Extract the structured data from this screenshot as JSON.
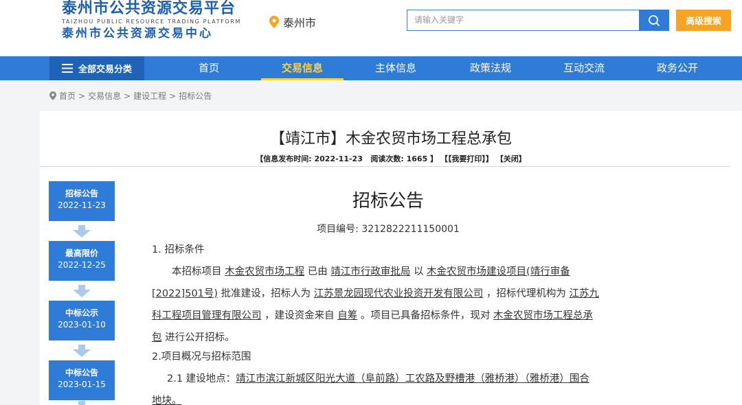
{
  "header": {
    "logo_cn_1": "泰州市公共资源交易平台",
    "logo_en": "TAIZHOU PUBLIC RESOURCE TRADING PLATFORM",
    "logo_cn_2": "泰州市公共资源交易中心",
    "city": "泰州市",
    "search_placeholder": "请输入关键字",
    "advanced_search": "高级搜索"
  },
  "nav": {
    "all_categories": "全部交易分类",
    "items": [
      "首页",
      "交易信息",
      "主体信息",
      "政策法规",
      "互动交流",
      "政务公开"
    ],
    "active_index": 1
  },
  "breadcrumb": [
    "首页",
    ">",
    "交易信息",
    ">",
    "建设工程",
    ">",
    "招标公告"
  ],
  "article": {
    "title": "【靖江市】木金农贸市场工程总承包",
    "meta": {
      "publish_label": "【信息发布时间:",
      "publish_date": "2022-11-23",
      "views_label": "阅读次数:",
      "views": "1665",
      "close_bracket": "】",
      "print": "【【我要打印】】",
      "close": "【关闭】"
    }
  },
  "timeline": [
    {
      "label": "招标公告",
      "date": "2022-11-23"
    },
    {
      "label": "最高限价",
      "date": "2022-12-25"
    },
    {
      "label": "中标公示",
      "date": "2023-01-10"
    },
    {
      "label": "中标公告",
      "date": "2023-01-15"
    }
  ],
  "doc": {
    "heading": "招标公告",
    "project_no_label": "项目编号:",
    "project_no": "3212822211150001",
    "sec1_title": "1. 招标条件",
    "p1": {
      "t1": "本招标项目",
      "project": "木金农贸市场工程",
      "t2": "已由",
      "approver": "靖江市行政审批局",
      "t3": "以",
      "approval_1": "木金农贸市场建设项目(靖行审备",
      "approval_2": "[2022]501号)",
      "t4": "批准建设，招标人为",
      "tenderer": "江苏景龙园现代农业投资开发有限公司",
      "t5": "，招标代理机构为",
      "agency_1": "江苏九",
      "agency_2": "科工程项目管理有限公司",
      "t6": "，建设资金来自",
      "funding": "自筹",
      "t7": "。项目已具备招标条件，现对",
      "target_1": "木金农贸市场工程总承",
      "target_2": "包",
      "t8": "进行公开招标。"
    },
    "sec2_title": "2.项目概况与招标范围",
    "p2": {
      "label": "2.1 建设地点：",
      "loc_1": "靖江市滨江新城区阳光大道（阜前路）工农路及野槽港（雅桥港）（雅桥港）围合",
      "loc_2": "地块。"
    }
  }
}
